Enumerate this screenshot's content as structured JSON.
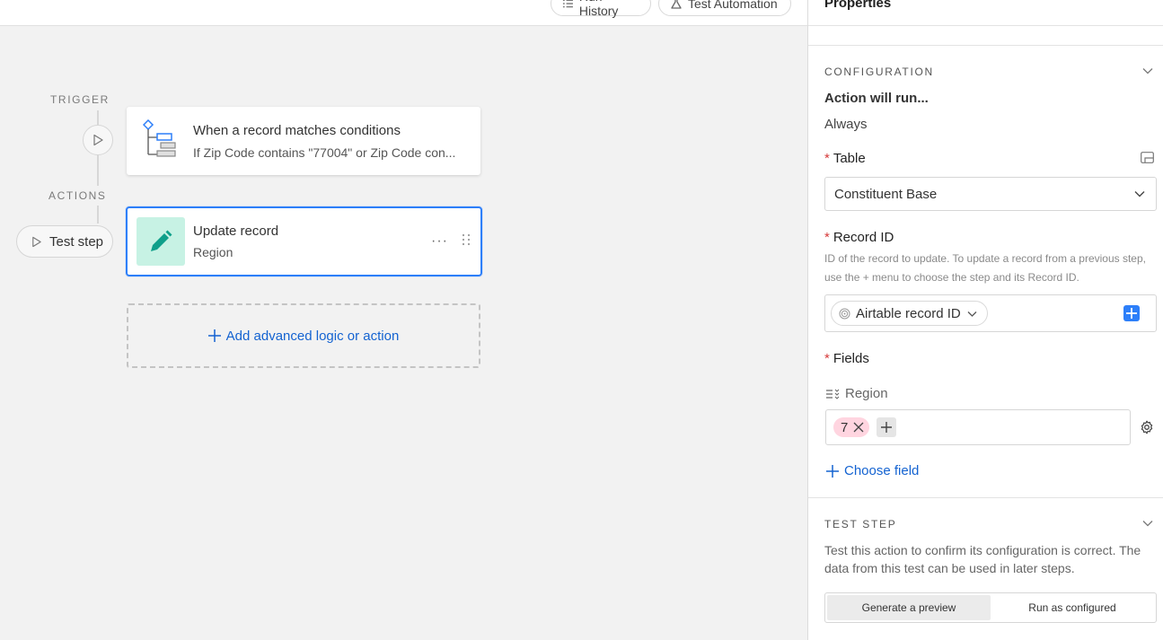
{
  "toolbar": {
    "run_history": "Run History",
    "test_automation": "Test Automation"
  },
  "canvas": {
    "trigger_label": "TRIGGER",
    "actions_label": "ACTIONS",
    "test_step": "Test step",
    "trigger": {
      "title": "When a record matches conditions",
      "subtitle": "If Zip Code contains \"77004\" or Zip Code con..."
    },
    "action": {
      "title": "Update record",
      "subtitle": "Region",
      "more": "···"
    },
    "add_action": "Add advanced logic or action"
  },
  "panel": {
    "title": "Properties",
    "configuration": {
      "heading": "CONFIGURATION",
      "run_label": "Action will run...",
      "run_value": "Always",
      "table_label": "Table",
      "table_value": "Constituent Base",
      "record_id_label": "Record ID",
      "record_id_hint": "ID of the record to update. To update a record from a previous step, use the + menu to choose the step and its Record ID.",
      "record_id_token": "Airtable record ID",
      "fields_label": "Fields",
      "field_name": "Region",
      "field_value": "7",
      "choose_field": "Choose field",
      "required_mark": "*"
    },
    "test_step": {
      "heading": "TEST STEP",
      "description": "Test this action to confirm its configuration is correct. The data from this test can be used in later steps.",
      "generate_preview": "Generate a preview",
      "run_as_configured": "Run as configured"
    }
  },
  "colors": {
    "accent": "#2d7ff9",
    "link": "#1463d1",
    "pencil_bg": "#c7f2e4",
    "pencil": "#0f9f8a",
    "tag_bg": "#ffd5e0",
    "required": "#d63a3a"
  }
}
